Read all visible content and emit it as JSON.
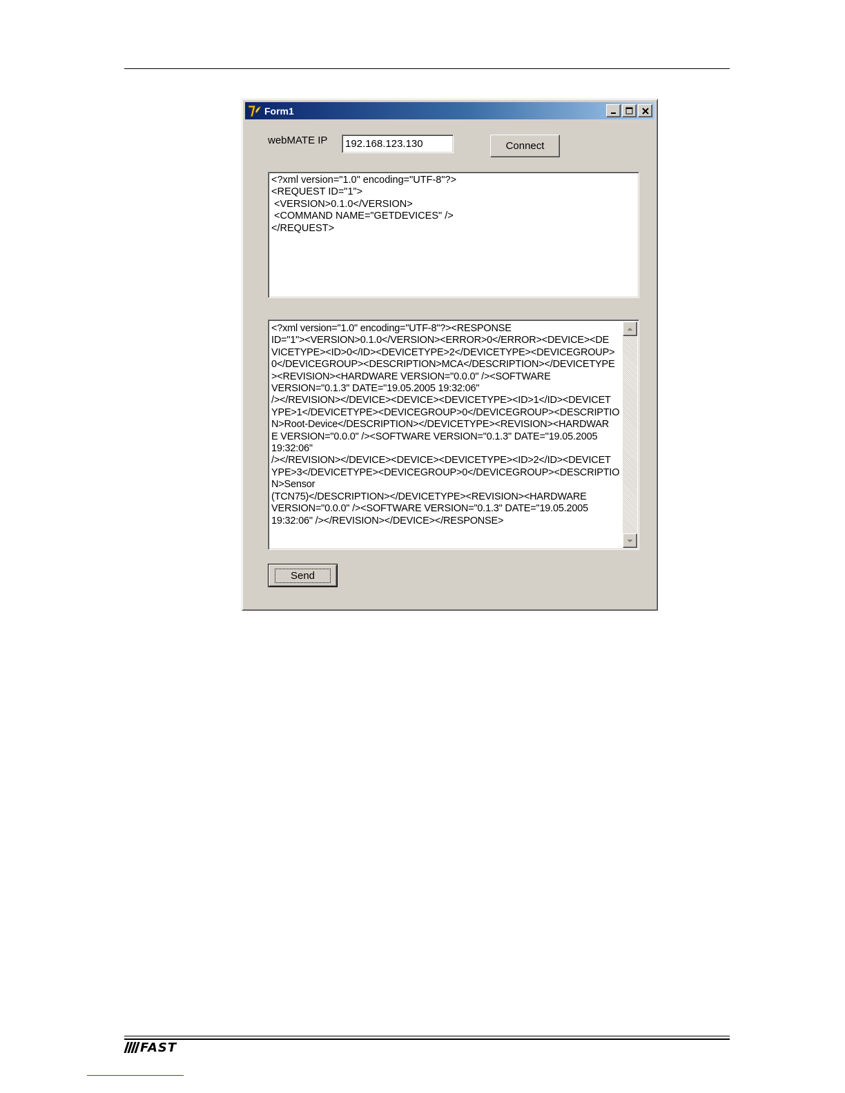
{
  "window": {
    "title": "Form1"
  },
  "form": {
    "ip_label": "webMATE IP",
    "ip_value": "192.168.123.130",
    "connect_label": "Connect",
    "send_label": "Send",
    "request_text": "<?xml version=\"1.0\" encoding=\"UTF-8\"?>\n<REQUEST ID=\"1\">\n <VERSION>0.1.0</VERSION>\n <COMMAND NAME=\"GETDEVICES\" />\n</REQUEST>",
    "response_text": "<?xml version=\"1.0\" encoding=\"UTF-8\"?><RESPONSE\nID=\"1\"><VERSION>0.1.0</VERSION><ERROR>0</ERROR><DEVICE><DE\nVICETYPE><ID>0</ID><DEVICETYPE>2</DEVICETYPE><DEVICEGROUP>\n0</DEVICEGROUP><DESCRIPTION>MCA</DESCRIPTION></DEVICETYPE\n><REVISION><HARDWARE VERSION=\"0.0.0\" /><SOFTWARE\nVERSION=\"0.1.3\" DATE=\"19.05.2005 19:32:06\"\n/></REVISION></DEVICE><DEVICE><DEVICETYPE><ID>1</ID><DEVICET\nYPE>1</DEVICETYPE><DEVICEGROUP>0</DEVICEGROUP><DESCRIPTIO\nN>Root-Device</DESCRIPTION></DEVICETYPE><REVISION><HARDWAR\nE VERSION=\"0.0.0\" /><SOFTWARE VERSION=\"0.1.3\" DATE=\"19.05.2005\n19:32:06\"\n/></REVISION></DEVICE><DEVICE><DEVICETYPE><ID>2</ID><DEVICET\nYPE>3</DEVICETYPE><DEVICEGROUP>0</DEVICEGROUP><DESCRIPTIO\nN>Sensor\n(TCN75)</DESCRIPTION></DEVICETYPE><REVISION><HARDWARE\nVERSION=\"0.0.0\" /><SOFTWARE VERSION=\"0.1.3\" DATE=\"19.05.2005\n19:32:06\" /></REVISION></DEVICE></RESPONSE>"
  },
  "footer": {
    "logo_text": "FAST"
  },
  "icons": {
    "app": "delphi-app-icon",
    "minimize": "minimize-icon",
    "maximize": "maximize-icon",
    "close": "close-icon",
    "scroll_up": "scroll-up-arrow-icon",
    "scroll_down": "scroll-down-arrow-icon"
  },
  "colors": {
    "titlebar_start": "#0a246a",
    "titlebar_end": "#a6caf0",
    "window_face": "#d4d0c8"
  }
}
